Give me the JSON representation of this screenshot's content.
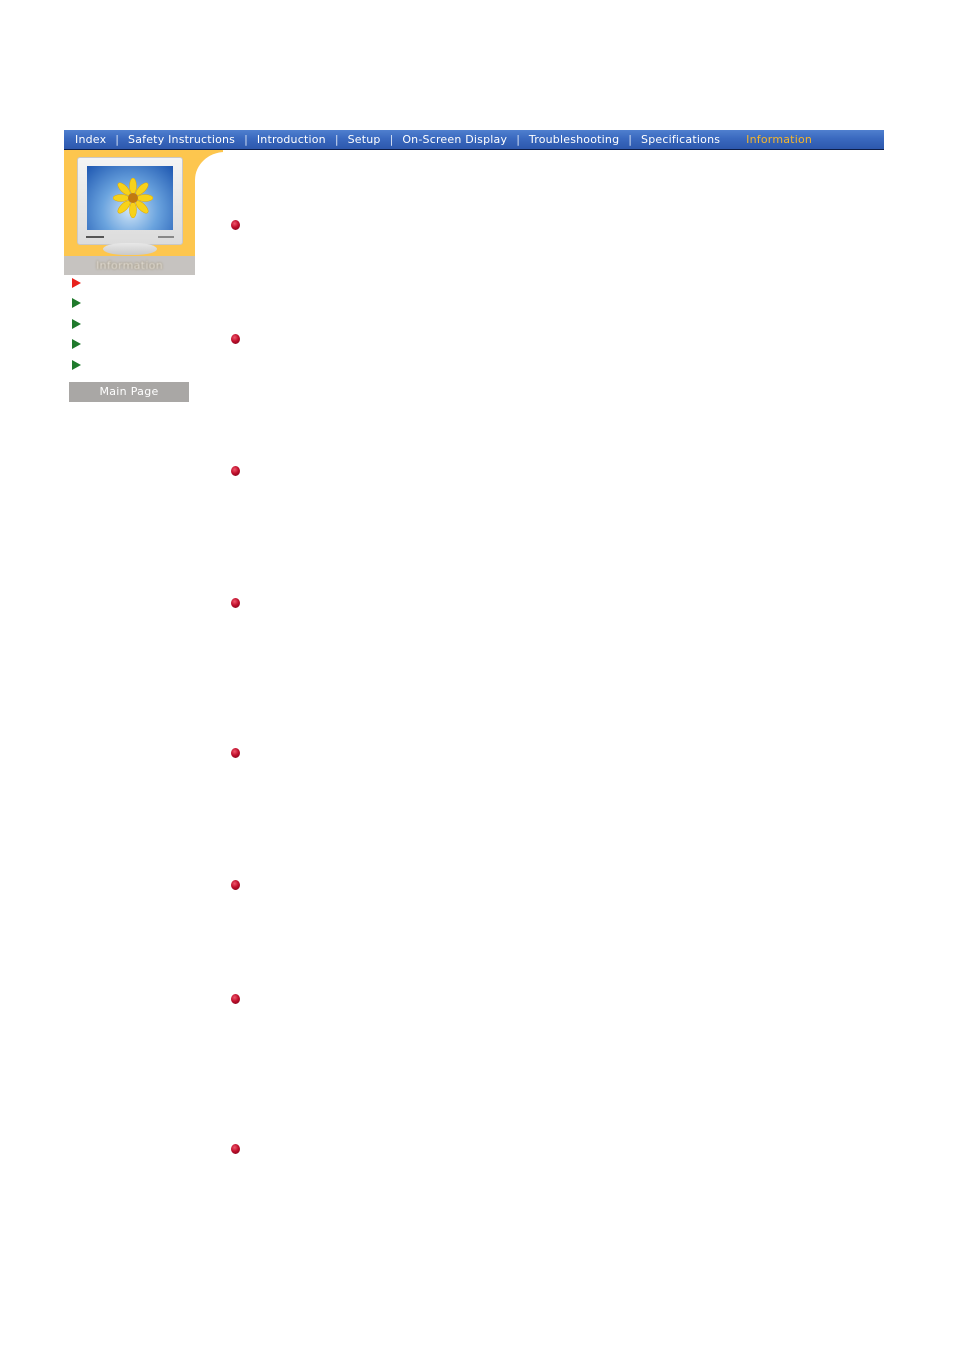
{
  "nav": {
    "items": [
      {
        "label": "Index",
        "active": false
      },
      {
        "label": "Safety Instructions",
        "active": false
      },
      {
        "label": "Introduction",
        "active": false
      },
      {
        "label": "Setup",
        "active": false
      },
      {
        "label": "On-Screen Display",
        "active": false
      },
      {
        "label": "Troubleshooting",
        "active": false
      },
      {
        "label": "Specifications",
        "active": false
      },
      {
        "label": "Information",
        "active": true
      }
    ],
    "colors": {
      "bar": "#3a69bf",
      "text": "#ffffff",
      "active_text": "#f5b52a"
    }
  },
  "sidebar": {
    "section_label": "Information",
    "image": "monitor-with-sunflower",
    "arrows": [
      {
        "state": "current",
        "icon": "red-arrow-icon"
      },
      {
        "state": "normal",
        "icon": "green-arrow-icon"
      },
      {
        "state": "normal",
        "icon": "green-arrow-icon"
      },
      {
        "state": "normal",
        "icon": "green-arrow-icon"
      },
      {
        "state": "normal",
        "icon": "green-arrow-icon"
      }
    ],
    "main_page_label": "Main Page",
    "colors": {
      "panel": "#fdc64e",
      "label_bar": "#c6c3c0",
      "button": "#a9a7a5",
      "current_arrow": "#e8221c",
      "arrow": "#1f7a2c"
    }
  },
  "content": {
    "bullet_count": 8,
    "bullet_icon": "red-sphere-bullet-icon",
    "bullet_color": "#c0102c"
  }
}
